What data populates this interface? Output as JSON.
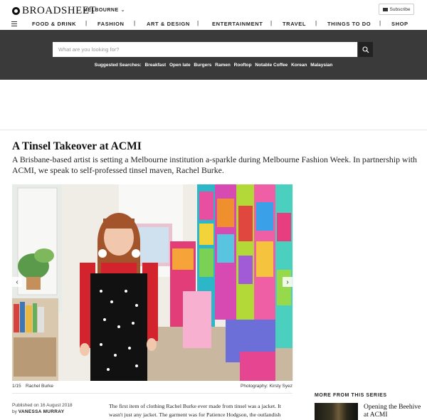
{
  "header": {
    "logo": "BROADSHEET",
    "city": "MELBOURNE",
    "subscribe": "Subscribe"
  },
  "nav": {
    "items": [
      "FOOD & DRINK",
      "FASHION",
      "ART & DESIGN",
      "ENTERTAINMENT",
      "TRAVEL",
      "THINGS TO DO",
      "SHOP"
    ]
  },
  "search": {
    "placeholder": "What are you looking for?",
    "suggested_label": "Suggested Searches:",
    "suggestions": [
      "Breakfast",
      "Open late",
      "Burgers",
      "Ramen",
      "Rooftop",
      "Notable Coffee",
      "Korean",
      "Malaysian"
    ]
  },
  "article": {
    "title": "A Tinsel Takeover at ACMI",
    "dek": "A Brisbane-based artist is setting a Melbourne institution a-sparkle during Melbourne Fashion Week. In partnership with ACMI, we speak to self-professed tinsel maven, Rachel Burke.",
    "photo": {
      "counter": "1/15",
      "subject": "Rachel Burke",
      "credit": "Photography: Kirsty Syez"
    },
    "published": "Published on 16 August 2018",
    "byline": "by",
    "author": "VANESSA MURRAY",
    "body": "The first item of clothing Rachel Burke ever made from tinsel was a jacket. It wasn't just any jacket. The garment was for Patience Hodgson, the outlandish"
  },
  "series": {
    "heading": "MORE FROM THIS SERIES",
    "item_title": "Opening the Beehive at ACMI"
  },
  "colors": {
    "search_band": "#3a3a3a",
    "search_button": "#222222"
  }
}
